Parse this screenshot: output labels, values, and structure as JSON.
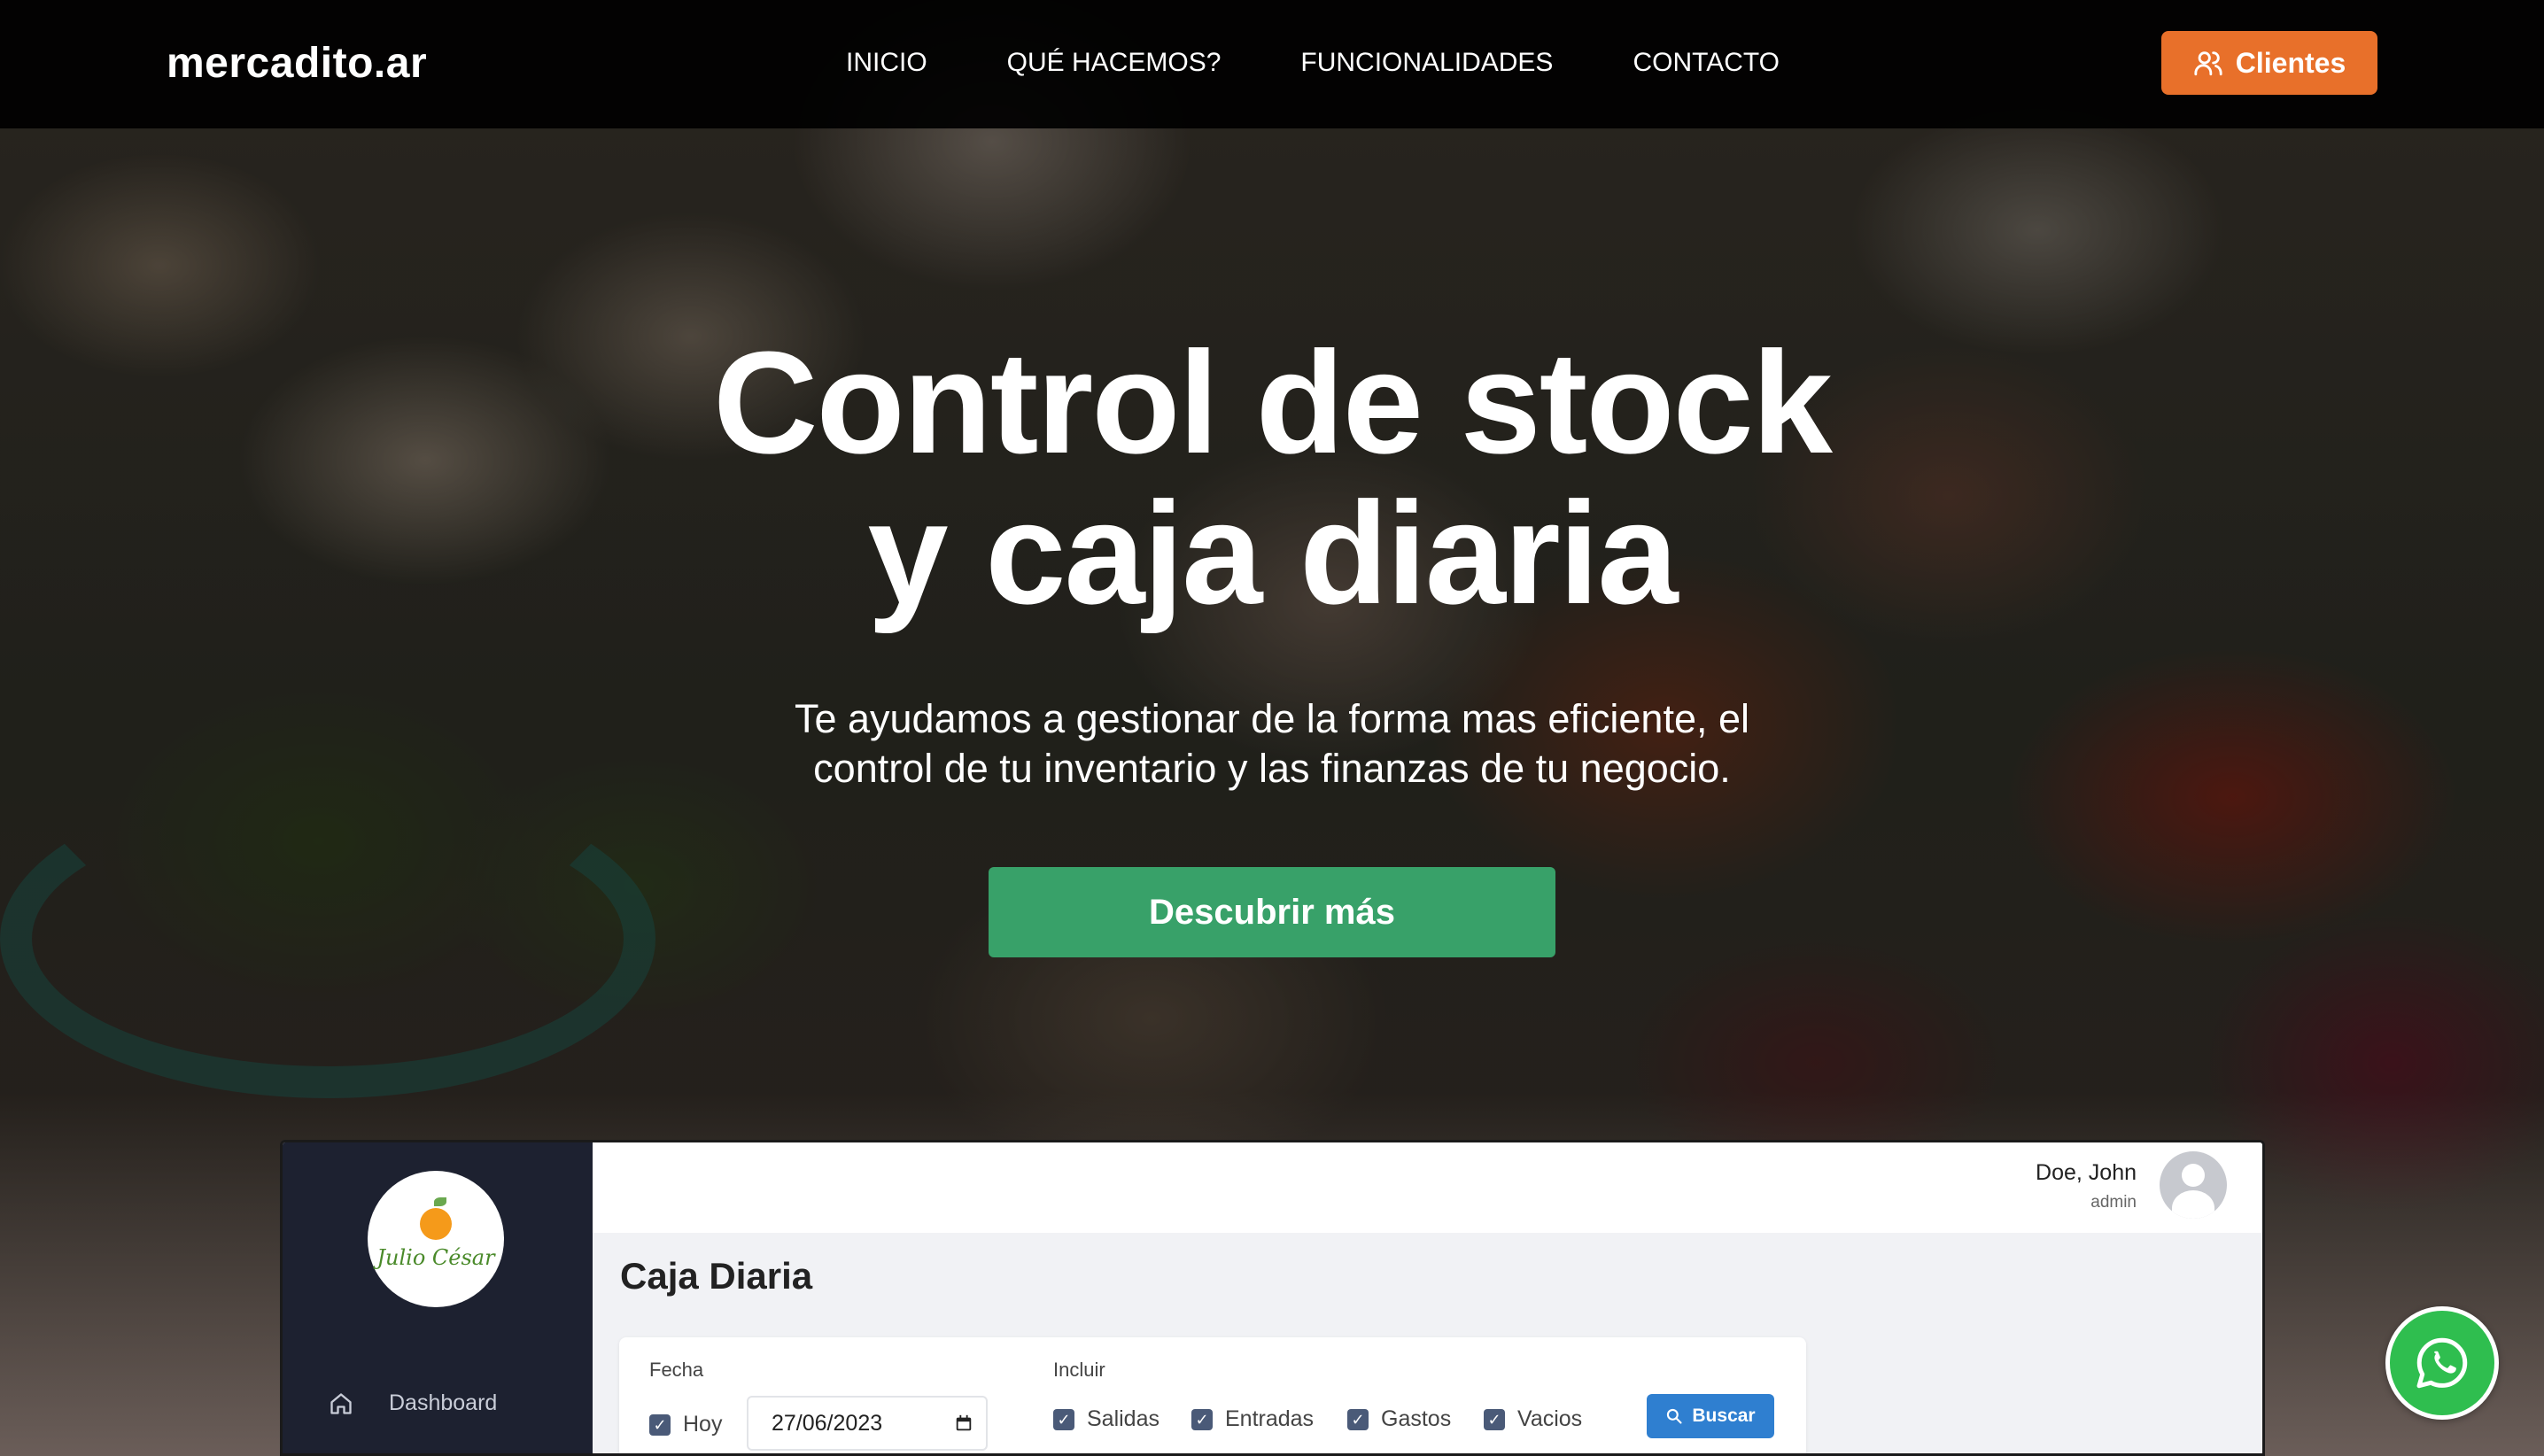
{
  "nav": {
    "brand": "mercadito.ar",
    "links": [
      "INICIO",
      "QUÉ HACEMOS?",
      "FUNCIONALIDADES",
      "CONTACTO"
    ],
    "clientes_label": "Clientes",
    "accent_color": "#e8702a"
  },
  "hero": {
    "title_line1": "Control de stock",
    "title_line2": "y caja diaria",
    "subtitle_line1": "Te ayudamos a gestionar de la forma mas eficiente, el",
    "subtitle_line2": "control de tu inventario y las finanzas de tu negocio.",
    "cta_label": "Descubrir más",
    "cta_color": "#38a169"
  },
  "preview": {
    "logo_text": "Julio César",
    "sidebar": {
      "items": [
        {
          "label": "Dashboard",
          "icon": "home-icon"
        }
      ]
    },
    "user": {
      "name": "Doe, John",
      "role": "admin"
    },
    "page_title": "Caja Diaria",
    "filters": {
      "fecha_label": "Fecha",
      "hoy_label": "Hoy",
      "hoy_checked": true,
      "date_value": "27/06/2023",
      "incluir_label": "Incluir",
      "options": [
        {
          "label": "Salidas",
          "checked": true
        },
        {
          "label": "Entradas",
          "checked": true
        },
        {
          "label": "Gastos",
          "checked": true
        },
        {
          "label": "Vacios",
          "checked": true
        }
      ],
      "buscar_label": "Buscar"
    }
  },
  "floating": {
    "icon": "whatsapp-icon",
    "color": "#2fbe4f"
  }
}
